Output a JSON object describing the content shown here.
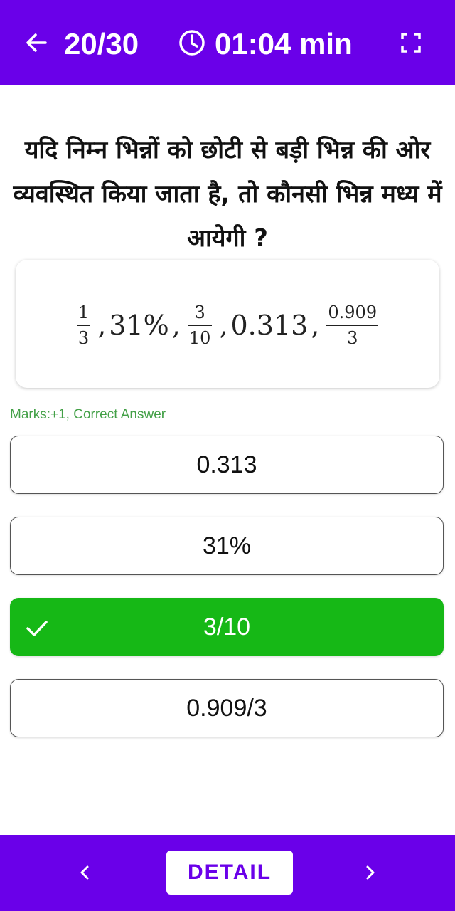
{
  "header": {
    "counter": "20/30",
    "timer": "01:04 min"
  },
  "question": {
    "text": "यदि निम्न भिन्नों को छोटी से बड़ी भिन्न की ओर व्यवस्थित किया जाता है, तो कौनसी भिन्न मध्य में आयेगी ?"
  },
  "expression": {
    "frac1_num": "1",
    "frac1_den": "3",
    "sep1": ",",
    "percent": "31%",
    "sep2": ",",
    "frac2_num": "3",
    "frac2_den": "10",
    "sep3": ",",
    "decimal": "0.313",
    "sep4": ",",
    "frac3_num": "0.909",
    "frac3_den": "3"
  },
  "marks": "Marks:+1, Correct Answer",
  "options": [
    {
      "label": "0.313",
      "correct": false
    },
    {
      "label": "31%",
      "correct": false
    },
    {
      "label": "3/10",
      "correct": true
    },
    {
      "label": "0.909/3",
      "correct": false
    }
  ],
  "footer": {
    "detail_label": "DETAIL"
  },
  "colors": {
    "primary": "#6a00e9",
    "correct": "#16b816",
    "marks": "#43a047"
  },
  "icons": {
    "back": "arrow-left-icon",
    "clock": "clock-icon",
    "fullscreen": "fullscreen-icon",
    "check": "check-icon",
    "prev": "chevron-left-icon",
    "next": "chevron-right-icon"
  }
}
